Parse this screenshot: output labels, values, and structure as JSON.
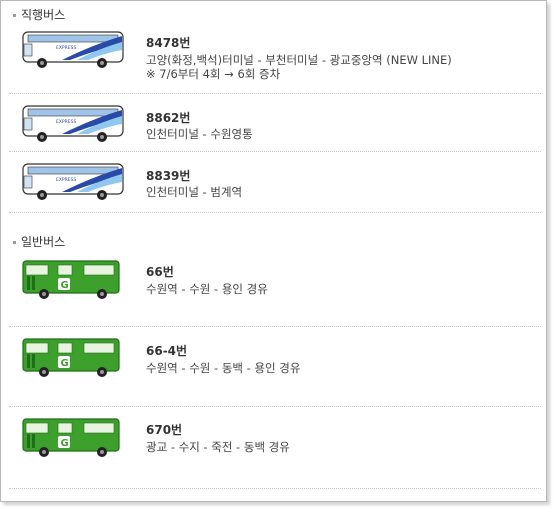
{
  "sections": [
    {
      "title": "직행버스",
      "routes": [
        {
          "number": "8478번",
          "desc": [
            "고양(화정,백석)터미널 - 부천터미널 - 광교중앙역 (NEW LINE)",
            "※ 7/6부터 4회 → 6회 증차"
          ],
          "bus_type": "express",
          "bus_text": "EXPRESS"
        },
        {
          "number": "8862번",
          "desc": [
            "인천터미널 - 수원영통"
          ],
          "bus_type": "express",
          "bus_text": "EXPRESS"
        },
        {
          "number": "8839번",
          "desc": [
            "인천터미널 - 범계역"
          ],
          "bus_type": "express",
          "bus_text": "EXPRESS"
        }
      ]
    },
    {
      "title": "일반버스",
      "routes": [
        {
          "number": "66번",
          "desc": [
            "수원역 - 수원 - 용인 경유"
          ],
          "bus_type": "city",
          "bus_text": "G"
        },
        {
          "number": "66-4번",
          "desc": [
            "수원역 - 수원 - 동백 - 용인 경유"
          ],
          "bus_type": "city",
          "bus_text": "G"
        },
        {
          "number": "670번",
          "desc": [
            "광교 - 수지 - 죽전 - 동백 경유"
          ],
          "bus_type": "city",
          "bus_text": "G"
        }
      ]
    }
  ],
  "colors": {
    "express_body": "#ffffff",
    "express_stripe": "#2a4aa8",
    "express_light": "#8fc7ee",
    "city_body": "#3ea02c",
    "city_dark": "#1f6e18"
  }
}
